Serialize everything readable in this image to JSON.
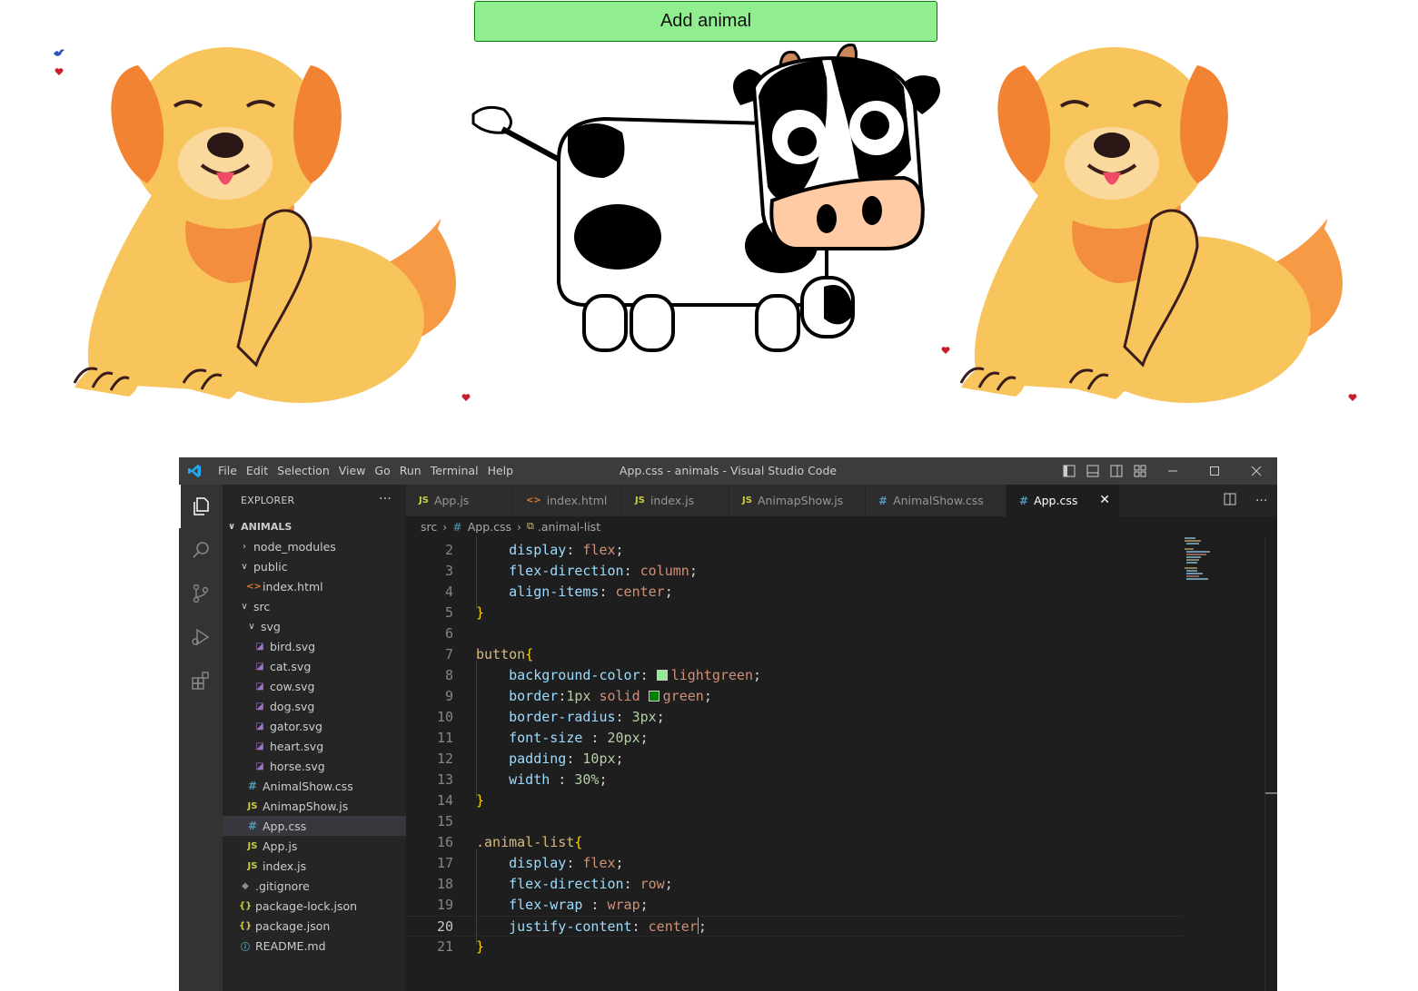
{
  "app": {
    "add_button_label": "Add animal",
    "animals": [
      {
        "name": "dog"
      },
      {
        "name": "cow"
      },
      {
        "name": "dog"
      }
    ],
    "extras": [
      "bird-icon",
      "heart-icon"
    ]
  },
  "vscode": {
    "window_title": "App.css - animals - Visual Studio Code",
    "menu": [
      "File",
      "Edit",
      "Selection",
      "View",
      "Go",
      "Run",
      "Terminal",
      "Help"
    ],
    "explorer": {
      "header": "EXPLORER",
      "more": "···",
      "section": "ANIMALS",
      "tree": [
        {
          "label": "node_modules",
          "type": "folder",
          "depth": 1,
          "expanded": false
        },
        {
          "label": "public",
          "type": "folder",
          "depth": 1,
          "expanded": true
        },
        {
          "label": "index.html",
          "type": "html",
          "depth": 2
        },
        {
          "label": "src",
          "type": "folder",
          "depth": 1,
          "expanded": true
        },
        {
          "label": "svg",
          "type": "folder",
          "depth": 2,
          "expanded": true
        },
        {
          "label": "bird.svg",
          "type": "svg",
          "depth": 3
        },
        {
          "label": "cat.svg",
          "type": "svg",
          "depth": 3
        },
        {
          "label": "cow.svg",
          "type": "svg",
          "depth": 3
        },
        {
          "label": "dog.svg",
          "type": "svg",
          "depth": 3
        },
        {
          "label": "gator.svg",
          "type": "svg",
          "depth": 3
        },
        {
          "label": "heart.svg",
          "type": "svg",
          "depth": 3
        },
        {
          "label": "horse.svg",
          "type": "svg",
          "depth": 3
        },
        {
          "label": "AnimalShow.css",
          "type": "css",
          "depth": 2
        },
        {
          "label": "AnimapShow.js",
          "type": "js",
          "depth": 2
        },
        {
          "label": "App.css",
          "type": "css",
          "depth": 2,
          "selected": true
        },
        {
          "label": "App.js",
          "type": "js",
          "depth": 2
        },
        {
          "label": "index.js",
          "type": "js",
          "depth": 2
        },
        {
          "label": ".gitignore",
          "type": "git",
          "depth": 1
        },
        {
          "label": "package-lock.json",
          "type": "json",
          "depth": 1
        },
        {
          "label": "package.json",
          "type": "json",
          "depth": 1
        },
        {
          "label": "README.md",
          "type": "md",
          "depth": 1
        }
      ]
    },
    "tabs": [
      {
        "label": "App.js",
        "icon": "JS",
        "type": "js"
      },
      {
        "label": "index.html",
        "icon": "<>",
        "type": "html"
      },
      {
        "label": "index.js",
        "icon": "JS",
        "type": "js"
      },
      {
        "label": "AnimapShow.js",
        "icon": "JS",
        "type": "js"
      },
      {
        "label": "AnimalShow.css",
        "icon": "#",
        "type": "css"
      },
      {
        "label": "App.css",
        "icon": "#",
        "type": "css",
        "active": true,
        "close": "✕"
      }
    ],
    "breadcrumb": [
      "src",
      "App.css",
      ".animal-list"
    ],
    "editor": {
      "current_line": 20,
      "lines": [
        {
          "n": "2",
          "tokens": [
            [
              "    ",
              ""
            ],
            [
              "display",
              "prop"
            ],
            [
              ": ",
              ""
            ],
            [
              "flex",
              "val"
            ],
            [
              ";",
              ""
            ]
          ]
        },
        {
          "n": "3",
          "tokens": [
            [
              "    ",
              ""
            ],
            [
              "flex-direction",
              "prop"
            ],
            [
              ": ",
              ""
            ],
            [
              "column",
              "val"
            ],
            [
              ";",
              ""
            ]
          ]
        },
        {
          "n": "4",
          "tokens": [
            [
              "    ",
              ""
            ],
            [
              "align-items",
              "prop"
            ],
            [
              ": ",
              ""
            ],
            [
              "center",
              "val"
            ],
            [
              ";",
              ""
            ]
          ]
        },
        {
          "n": "5",
          "tokens": [
            [
              "}",
              "br"
            ]
          ]
        },
        {
          "n": "6",
          "tokens": []
        },
        {
          "n": "7",
          "tokens": [
            [
              "button",
              "tag"
            ],
            [
              "{",
              "br"
            ]
          ]
        },
        {
          "n": "8",
          "tokens": [
            [
              "    ",
              ""
            ],
            [
              "background-color",
              "prop"
            ],
            [
              ": ",
              ""
            ],
            [
              "#90ee90",
              "swatch"
            ],
            [
              "lightgreen",
              "val"
            ],
            [
              ";",
              ""
            ]
          ]
        },
        {
          "n": "9",
          "tokens": [
            [
              "    ",
              ""
            ],
            [
              "border",
              "prop"
            ],
            [
              ":",
              ""
            ],
            [
              "1px",
              "num"
            ],
            [
              " ",
              ""
            ],
            [
              "solid",
              "val"
            ],
            [
              " ",
              ""
            ],
            [
              "#008000",
              "swatch"
            ],
            [
              "green",
              "val"
            ],
            [
              ";",
              ""
            ]
          ]
        },
        {
          "n": "10",
          "tokens": [
            [
              "    ",
              ""
            ],
            [
              "border-radius",
              "prop"
            ],
            [
              ": ",
              ""
            ],
            [
              "3px",
              "num"
            ],
            [
              ";",
              ""
            ]
          ]
        },
        {
          "n": "11",
          "tokens": [
            [
              "    ",
              ""
            ],
            [
              "font-size",
              "prop"
            ],
            [
              " : ",
              ""
            ],
            [
              "20px",
              "num"
            ],
            [
              ";",
              ""
            ]
          ]
        },
        {
          "n": "12",
          "tokens": [
            [
              "    ",
              ""
            ],
            [
              "padding",
              "prop"
            ],
            [
              ": ",
              ""
            ],
            [
              "10px",
              "num"
            ],
            [
              ";",
              ""
            ]
          ]
        },
        {
          "n": "13",
          "tokens": [
            [
              "    ",
              ""
            ],
            [
              "width",
              "prop"
            ],
            [
              " : ",
              ""
            ],
            [
              "30%",
              "num"
            ],
            [
              ";",
              ""
            ]
          ]
        },
        {
          "n": "14",
          "tokens": [
            [
              "}",
              "br"
            ]
          ]
        },
        {
          "n": "15",
          "tokens": []
        },
        {
          "n": "16",
          "tokens": [
            [
              ".animal-list",
              "sel"
            ],
            [
              "{",
              "br"
            ]
          ]
        },
        {
          "n": "17",
          "tokens": [
            [
              "    ",
              ""
            ],
            [
              "display",
              "prop"
            ],
            [
              ": ",
              ""
            ],
            [
              "flex",
              "val"
            ],
            [
              ";",
              ""
            ]
          ]
        },
        {
          "n": "18",
          "tokens": [
            [
              "    ",
              ""
            ],
            [
              "flex-direction",
              "prop"
            ],
            [
              ": ",
              ""
            ],
            [
              "row",
              "val"
            ],
            [
              ";",
              ""
            ]
          ]
        },
        {
          "n": "19",
          "tokens": [
            [
              "    ",
              ""
            ],
            [
              "flex-wrap",
              "prop"
            ],
            [
              " : ",
              ""
            ],
            [
              "wrap",
              "val"
            ],
            [
              ";",
              ""
            ]
          ]
        },
        {
          "n": "20",
          "tokens": [
            [
              "    ",
              ""
            ],
            [
              "justify-content",
              "prop"
            ],
            [
              ": ",
              ""
            ],
            [
              "center",
              "val"
            ],
            [
              "|",
              "caret"
            ],
            [
              ";",
              ""
            ]
          ]
        },
        {
          "n": "21",
          "tokens": [
            [
              "}",
              "br"
            ]
          ]
        }
      ]
    },
    "colors": {
      "accent": "#007acc",
      "editor_bg": "#1e1e1e",
      "sidebar_bg": "#252526",
      "titlebar_bg": "#3c3c3c",
      "button_bg": "#90ee90",
      "button_border": "#008000"
    }
  }
}
